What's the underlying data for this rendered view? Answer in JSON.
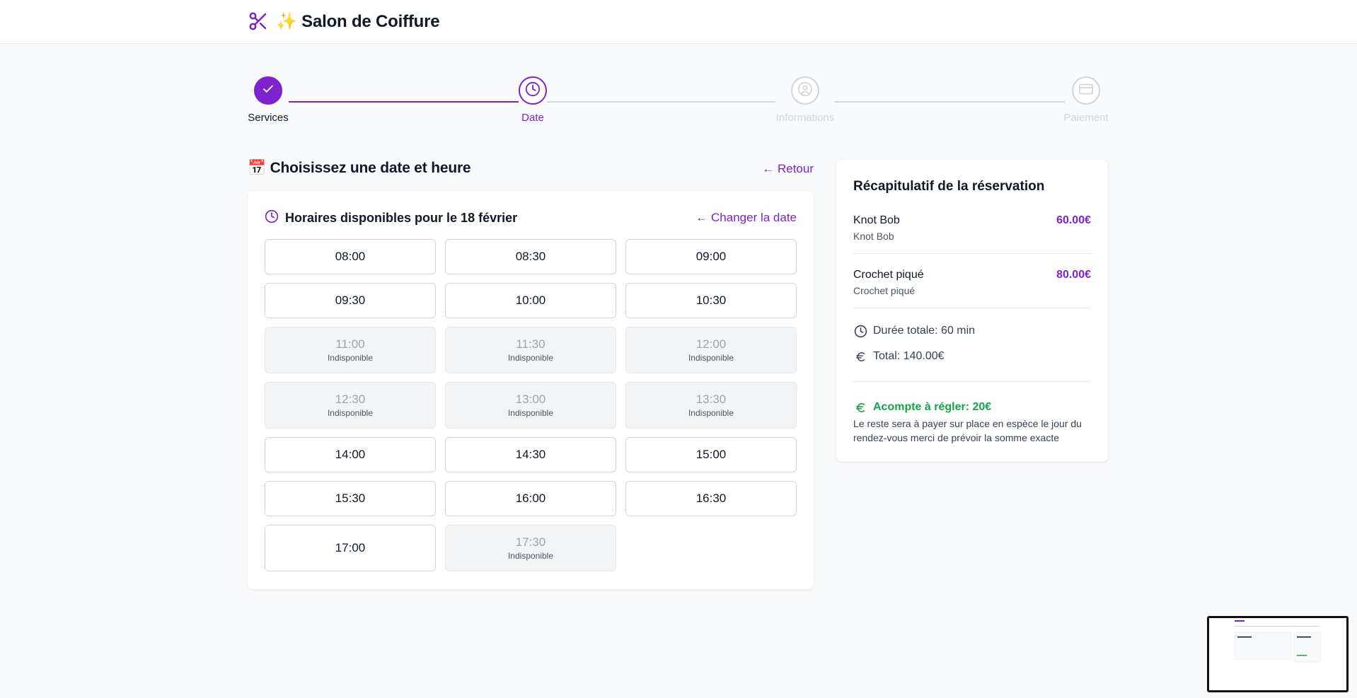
{
  "header": {
    "title": "✨ Salon de Coiffure",
    "logo_icon": "scissors-icon"
  },
  "stepper": {
    "steps": [
      {
        "label": "Services",
        "state": "complete",
        "icon": "check-icon"
      },
      {
        "label": "Date",
        "state": "current",
        "icon": "clock-icon"
      },
      {
        "label": "Informations",
        "state": "upcoming",
        "icon": "user-icon"
      },
      {
        "label": "Paiement",
        "state": "upcoming",
        "icon": "credit-card-icon"
      }
    ]
  },
  "main": {
    "title": "📅 Choisissez une date et heure",
    "back_label": "← Retour",
    "slots_title": "Horaires disponibles pour le 18 février",
    "change_date_label": "← Changer la date",
    "unavailable_label": "Indisponible",
    "slots": [
      {
        "time": "08:00",
        "available": true
      },
      {
        "time": "08:30",
        "available": true
      },
      {
        "time": "09:00",
        "available": true
      },
      {
        "time": "09:30",
        "available": true
      },
      {
        "time": "10:00",
        "available": true
      },
      {
        "time": "10:30",
        "available": true
      },
      {
        "time": "11:00",
        "available": false
      },
      {
        "time": "11:30",
        "available": false
      },
      {
        "time": "12:00",
        "available": false
      },
      {
        "time": "12:30",
        "available": false
      },
      {
        "time": "13:00",
        "available": false
      },
      {
        "time": "13:30",
        "available": false
      },
      {
        "time": "14:00",
        "available": true
      },
      {
        "time": "14:30",
        "available": true
      },
      {
        "time": "15:00",
        "available": true
      },
      {
        "time": "15:30",
        "available": true
      },
      {
        "time": "16:00",
        "available": true
      },
      {
        "time": "16:30",
        "available": true
      },
      {
        "time": "17:00",
        "available": true
      },
      {
        "time": "17:30",
        "available": false
      }
    ]
  },
  "summary": {
    "title": "Récapitulatif de la réservation",
    "services": [
      {
        "name": "Knot Bob",
        "subtitle": "Knot Bob",
        "price": "60.00€"
      },
      {
        "name": "Crochet piqué",
        "subtitle": "Crochet piqué",
        "price": "80.00€"
      }
    ],
    "duration": "Durée totale: 60 min",
    "total": "Total: 140.00€",
    "deposit": "Acompte à régler: 20€",
    "deposit_note": "Le reste sera à payer sur place en espèce le jour du rendez-vous merci de prévoir la somme exacte"
  },
  "colors": {
    "accent": "#7e22ce",
    "success": "#16a34a",
    "muted": "#d1d5db"
  }
}
